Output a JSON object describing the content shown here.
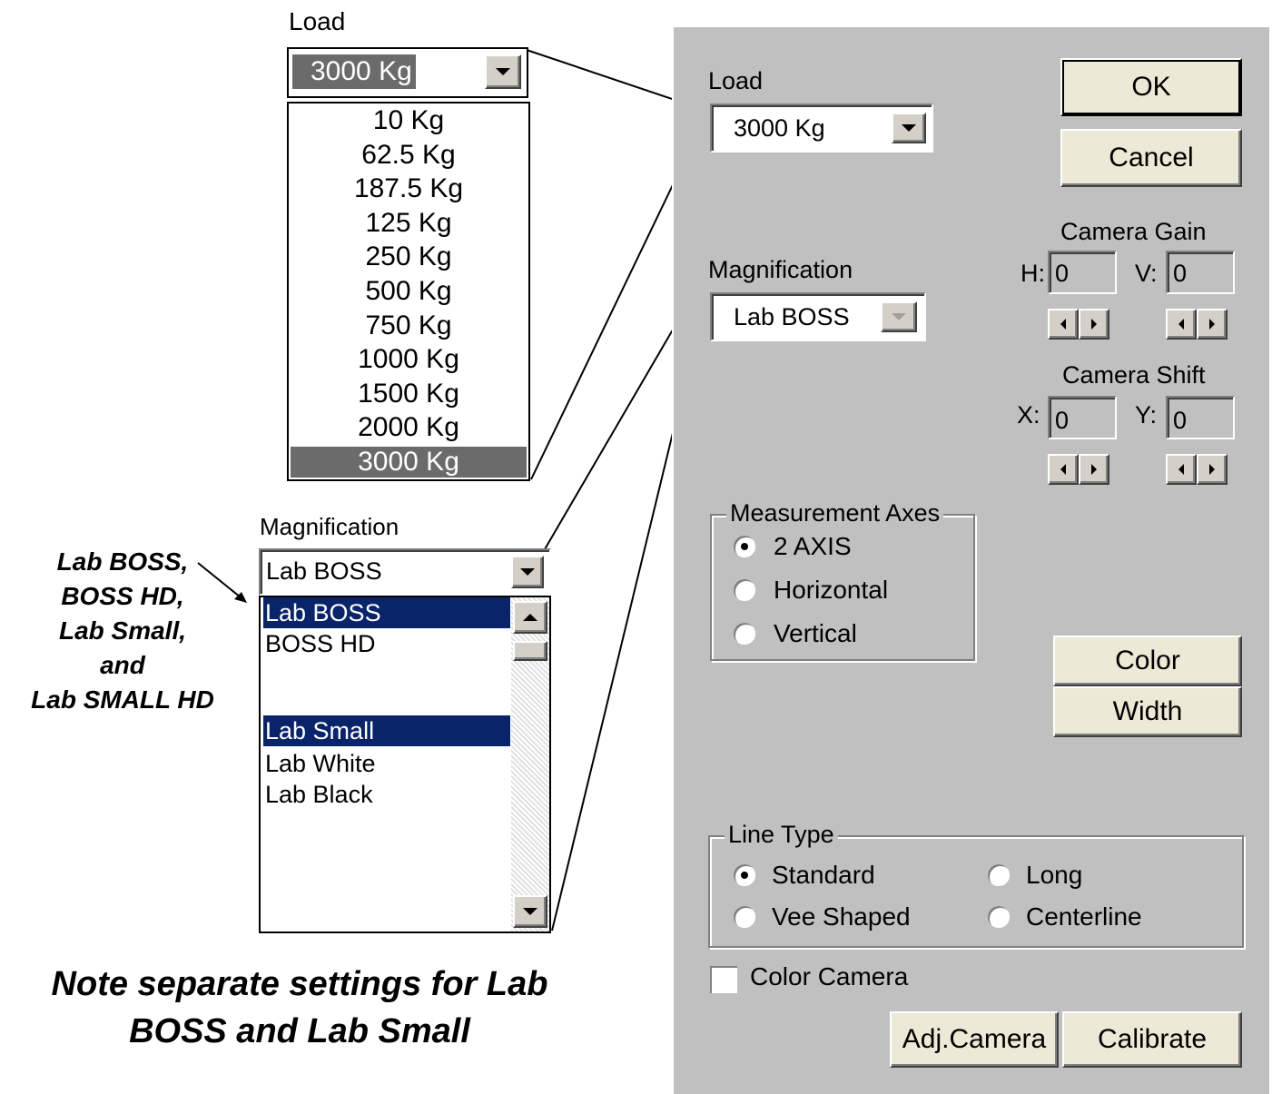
{
  "callout_load": {
    "label": "Load",
    "selected": "3000 Kg",
    "options": [
      "10 Kg",
      "62.5 Kg",
      "187.5 Kg",
      "125 Kg",
      "250 Kg",
      "500 Kg",
      "750 Kg",
      "1000 Kg",
      "1500 Kg",
      "2000 Kg",
      "3000 Kg"
    ]
  },
  "callout_magnification": {
    "label": "Magnification",
    "selected": "Lab BOSS",
    "options": [
      "Lab BOSS",
      "BOSS HD",
      "",
      "Lab Small",
      "Lab White",
      "Lab Black"
    ]
  },
  "annotation": {
    "side_note_lines": [
      "Lab BOSS,",
      "BOSS HD,",
      "Lab Small,",
      "and",
      "Lab SMALL HD"
    ],
    "bottom_note_lines": [
      "Note separate settings for Lab",
      "BOSS and Lab Small"
    ]
  },
  "dialog": {
    "load_label": "Load",
    "load_value": "3000 Kg",
    "magnification_label": "Magnification",
    "magnification_value": "Lab BOSS",
    "ok_label": "OK",
    "cancel_label": "Cancel",
    "camera_gain": {
      "title": "Camera Gain",
      "h_label": "H:",
      "h_value": "0",
      "v_label": "V:",
      "v_value": "0"
    },
    "camera_shift": {
      "title": "Camera Shift",
      "x_label": "X:",
      "x_value": "0",
      "y_label": "Y:",
      "y_value": "0"
    },
    "measurement_axes": {
      "title": "Measurement Axes",
      "options": [
        "2 AXIS",
        "Horizontal",
        "Vertical"
      ],
      "selected": "2 AXIS"
    },
    "color_label": "Color",
    "width_label": "Width",
    "line_type": {
      "title": "Line Type",
      "options": [
        "Standard",
        "Long",
        "Vee Shaped",
        "Centerline"
      ],
      "selected": "Standard"
    },
    "color_camera_label": "Color Camera",
    "color_camera_checked": false,
    "adj_camera_label": "Adj.Camera",
    "calibrate_label": "Calibrate"
  },
  "colors": {
    "dialog_bg": "#c0c0c0",
    "button_face": "#ece9d6",
    "selection": "#0a246a"
  }
}
